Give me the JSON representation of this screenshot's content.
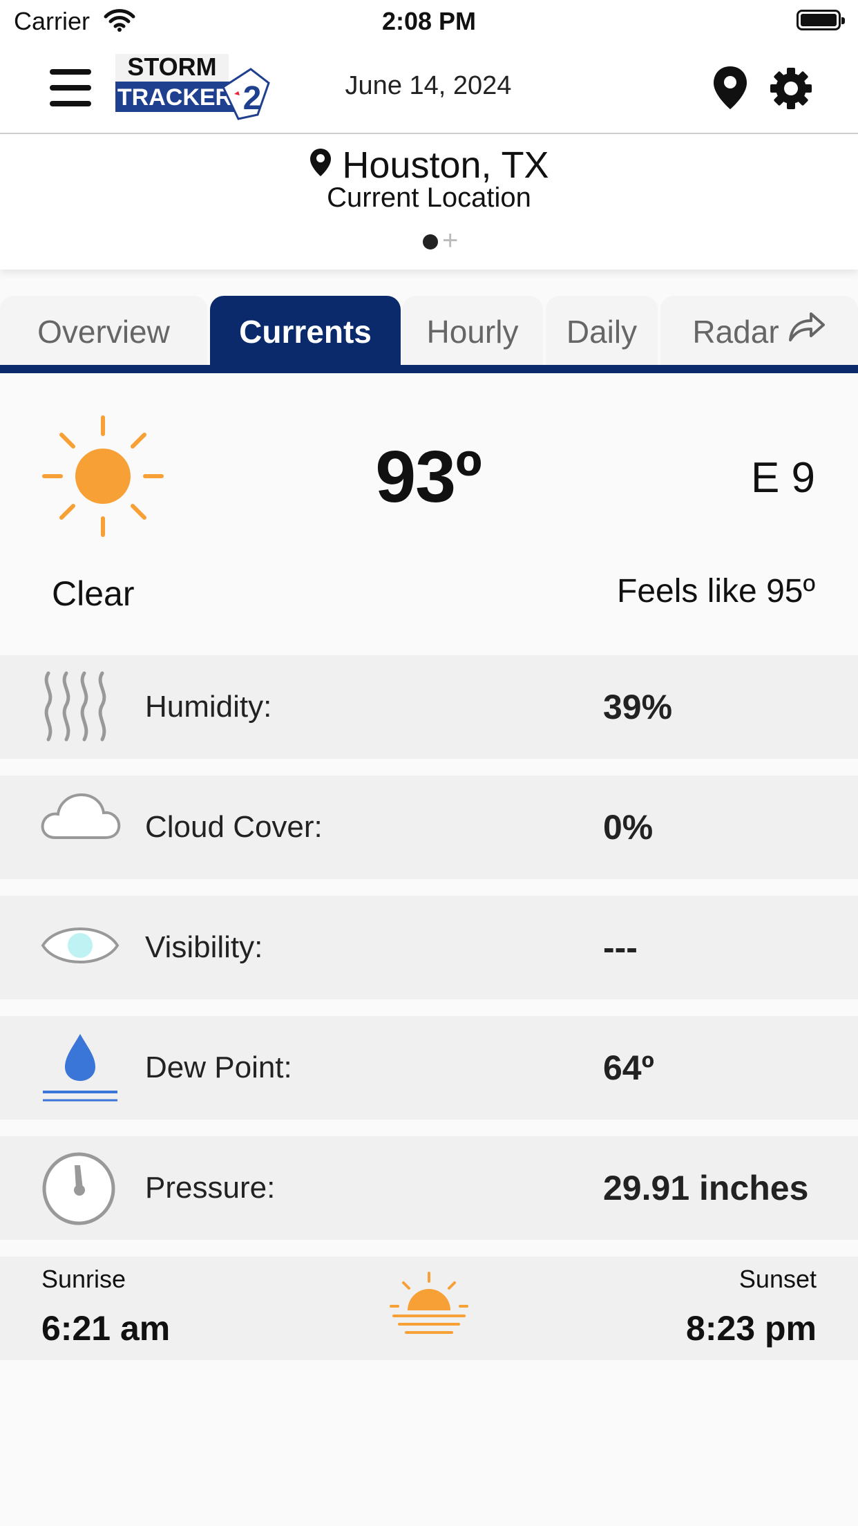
{
  "status_bar": {
    "carrier": "Carrier",
    "time": "2:08 PM"
  },
  "header": {
    "logo_text_top": "STORM",
    "logo_text_bottom": "TRACKER",
    "logo_number": "2",
    "date": "June 14, 2024",
    "icons": [
      "hamburger-menu-icon",
      "location-pin-icon",
      "gear-icon"
    ]
  },
  "location": {
    "city": "Houston, TX",
    "subtitle": "Current Location",
    "add_symbol": "+"
  },
  "tabs": [
    {
      "label": "Overview",
      "active": false
    },
    {
      "label": "Currents",
      "active": true
    },
    {
      "label": "Hourly",
      "active": false
    },
    {
      "label": "Daily",
      "active": false
    },
    {
      "label": "Radar",
      "active": false
    }
  ],
  "current": {
    "icon": "sun-icon",
    "temperature": "93º",
    "wind": "E 9",
    "condition": "Clear",
    "feels_like": "Feels like 95º"
  },
  "details": [
    {
      "label": "Humidity:",
      "value": "39%",
      "icon": "humidity-icon"
    },
    {
      "label": "Cloud Cover:",
      "value": "0%",
      "icon": "cloud-icon"
    },
    {
      "label": "Visibility:",
      "value": "---",
      "icon": "eye-icon"
    },
    {
      "label": "Dew Point:",
      "value": "64º",
      "icon": "dew-drop-icon"
    },
    {
      "label": "Pressure:",
      "value": "29.91 inches",
      "icon": "pressure-gauge-icon"
    }
  ],
  "sun": {
    "sunrise_label": "Sunrise",
    "sunrise_time": "6:21 am",
    "sunset_label": "Sunset",
    "sunset_time": "8:23 pm",
    "icon": "sunset-icon"
  },
  "colors": {
    "brand_navy": "#0a2a6b",
    "sun_orange": "#f7a035",
    "dew_blue": "#3a75d8",
    "eye_cyan": "#bff2f2"
  }
}
